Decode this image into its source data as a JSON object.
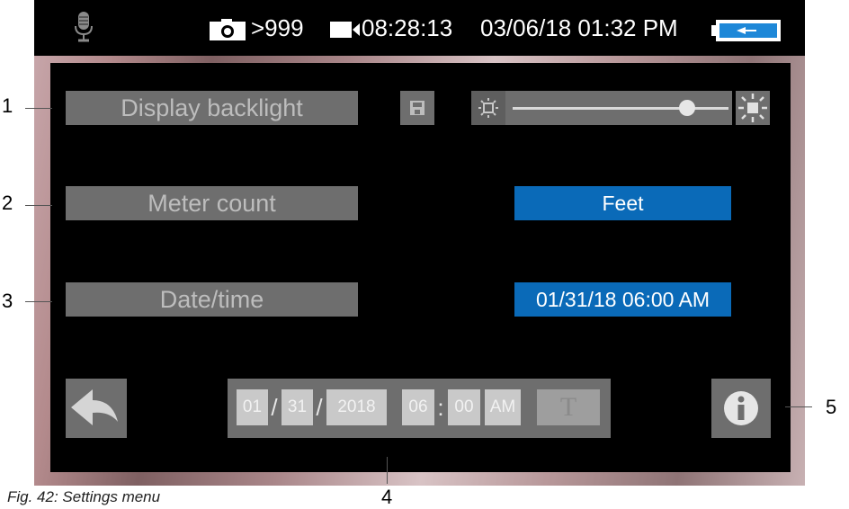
{
  "status_bar": {
    "photo_count": ">999",
    "record_time": "08:28:13",
    "datetime": "03/06/18 01:32 PM",
    "icons": [
      "microphone-icon",
      "camera-icon",
      "video-icon",
      "battery-charging-icon"
    ],
    "battery_color": "#1e88d8"
  },
  "settings": {
    "display_backlight": {
      "label": "Display backlight",
      "slider_level": 0.87
    },
    "meter_count": {
      "label": "Meter count",
      "value": "Feet"
    },
    "date_time": {
      "label": "Date/time",
      "value": "01/31/18 06:00 AM"
    }
  },
  "date_editor": {
    "month": "01",
    "day": "31",
    "year": "2018",
    "hour": "06",
    "minute": "00",
    "ampm": "AM",
    "date_separator": "/",
    "time_separator": ":",
    "text_button": "T"
  },
  "callouts": [
    "1",
    "2",
    "3",
    "4",
    "5"
  ],
  "caption": "Fig. 42: Settings menu",
  "colors": {
    "accent": "#0a6ab8",
    "label_bg": "#6e6e6e",
    "screen_bg": "#000000"
  }
}
